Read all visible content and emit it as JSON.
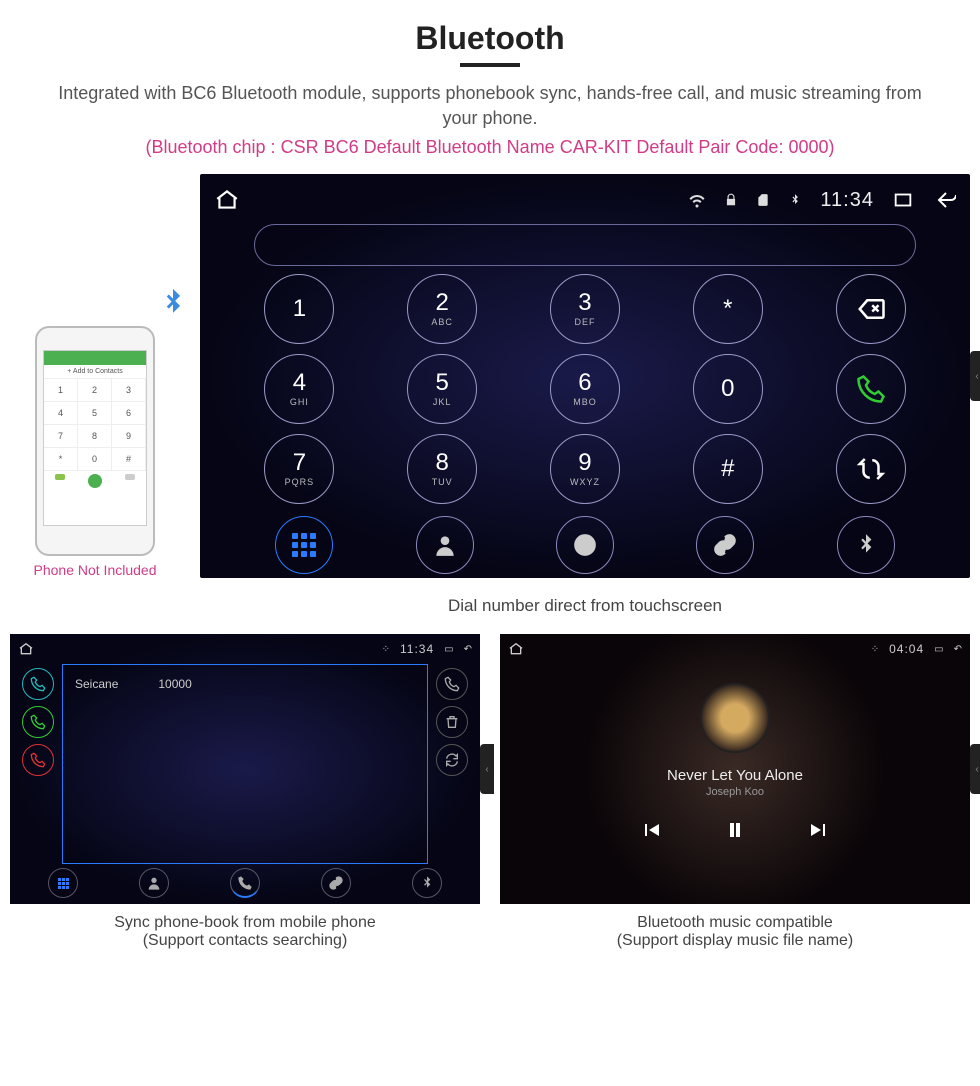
{
  "header": {
    "title": "Bluetooth",
    "description": "Integrated with BC6 Bluetooth module, supports phonebook sync, hands-free call, and music streaming from your phone.",
    "specs": "(Bluetooth chip : CSR BC6    Default Bluetooth Name CAR-KIT    Default Pair Code: 0000)"
  },
  "phone": {
    "not_included": "Phone Not Included",
    "add_contacts": "+  Add to Contacts",
    "pad": [
      "1",
      "2",
      "3",
      "4",
      "5",
      "6",
      "7",
      "8",
      "9",
      "*",
      "0",
      "#"
    ]
  },
  "dialer": {
    "status_time": "11:34",
    "keys": [
      {
        "n": "1",
        "l": ""
      },
      {
        "n": "2",
        "l": "ABC"
      },
      {
        "n": "3",
        "l": "DEF"
      },
      {
        "n": "*",
        "l": ""
      },
      {
        "n": "del",
        "l": ""
      },
      {
        "n": "4",
        "l": "GHI"
      },
      {
        "n": "5",
        "l": "JKL"
      },
      {
        "n": "6",
        "l": "MBO"
      },
      {
        "n": "0",
        "l": ""
      },
      {
        "n": "call",
        "l": ""
      },
      {
        "n": "7",
        "l": "PQRS"
      },
      {
        "n": "8",
        "l": "TUV"
      },
      {
        "n": "9",
        "l": "WXYZ"
      },
      {
        "n": "#",
        "l": ""
      },
      {
        "n": "swap",
        "l": ""
      }
    ],
    "nav": [
      "grid",
      "person",
      "call",
      "link",
      "bt"
    ],
    "caption": "Dial number direct from touchscreen"
  },
  "phonebook": {
    "status_time": "11:34",
    "contact_name": "Seicane",
    "contact_num": "10000",
    "caption_l1": "Sync phone-book from mobile phone",
    "caption_l2": "(Support contacts searching)"
  },
  "music": {
    "status_time": "04:04",
    "song": "Never Let You Alone",
    "artist": "Joseph Koo",
    "caption_l1": "Bluetooth music compatible",
    "caption_l2": "(Support display music file name)"
  }
}
